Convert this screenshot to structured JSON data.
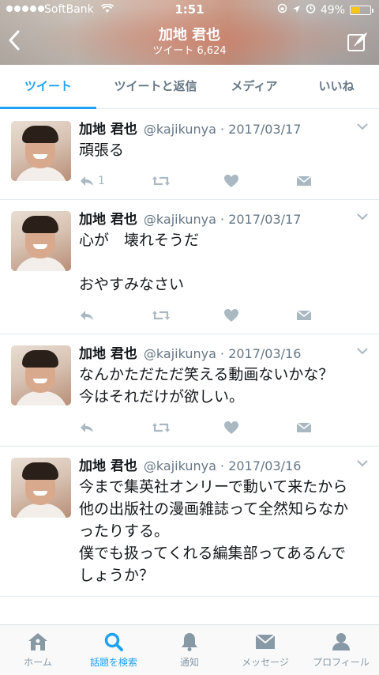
{
  "status_bar": {
    "carrier": "SoftBank",
    "time": "1:51",
    "battery_percent": "49%",
    "battery_level": 0.49
  },
  "header": {
    "title": "加地 君也",
    "subtitle": "ツイート 6,624"
  },
  "tabs": [
    {
      "label": "ツイート",
      "active": true
    },
    {
      "label": "ツイートと返信",
      "active": false
    },
    {
      "label": "メディア",
      "active": false
    },
    {
      "label": "いいね",
      "active": false
    }
  ],
  "tweets": [
    {
      "name": "加地 君也",
      "handle": "@kajikunya · 2017/03/17",
      "text": "頑張る",
      "reply_count": "1"
    },
    {
      "name": "加地 君也",
      "handle": "@kajikunya · 2017/03/17",
      "text": "心が　壊れそうだ\n\nおやすみなさい",
      "reply_count": ""
    },
    {
      "name": "加地 君也",
      "handle": "@kajikunya · 2017/03/16",
      "text": "なんかただただ笑える動画ないかな？\n今はそれだけが欲しい。",
      "reply_count": ""
    },
    {
      "name": "加地 君也",
      "handle": "@kajikunya · 2017/03/16",
      "text": "今まで集英社オンリーで動いて来たから他の出版社の漫画雑誌って全然知らなかったりする。\n僕でも扱ってくれる編集部ってあるんでしょうか？",
      "reply_count": ""
    }
  ],
  "bottom_nav": [
    {
      "label": "ホーム",
      "icon": "home-icon",
      "active": false
    },
    {
      "label": "話題を検索",
      "icon": "search-icon",
      "active": true
    },
    {
      "label": "通知",
      "icon": "bell-icon",
      "active": false
    },
    {
      "label": "メッセージ",
      "icon": "envelope-icon",
      "active": false
    },
    {
      "label": "プロフィール",
      "icon": "person-icon",
      "active": false
    }
  ],
  "colors": {
    "accent": "#1da1f2",
    "muted": "#657786",
    "icon_gray": "#aab8c2"
  }
}
